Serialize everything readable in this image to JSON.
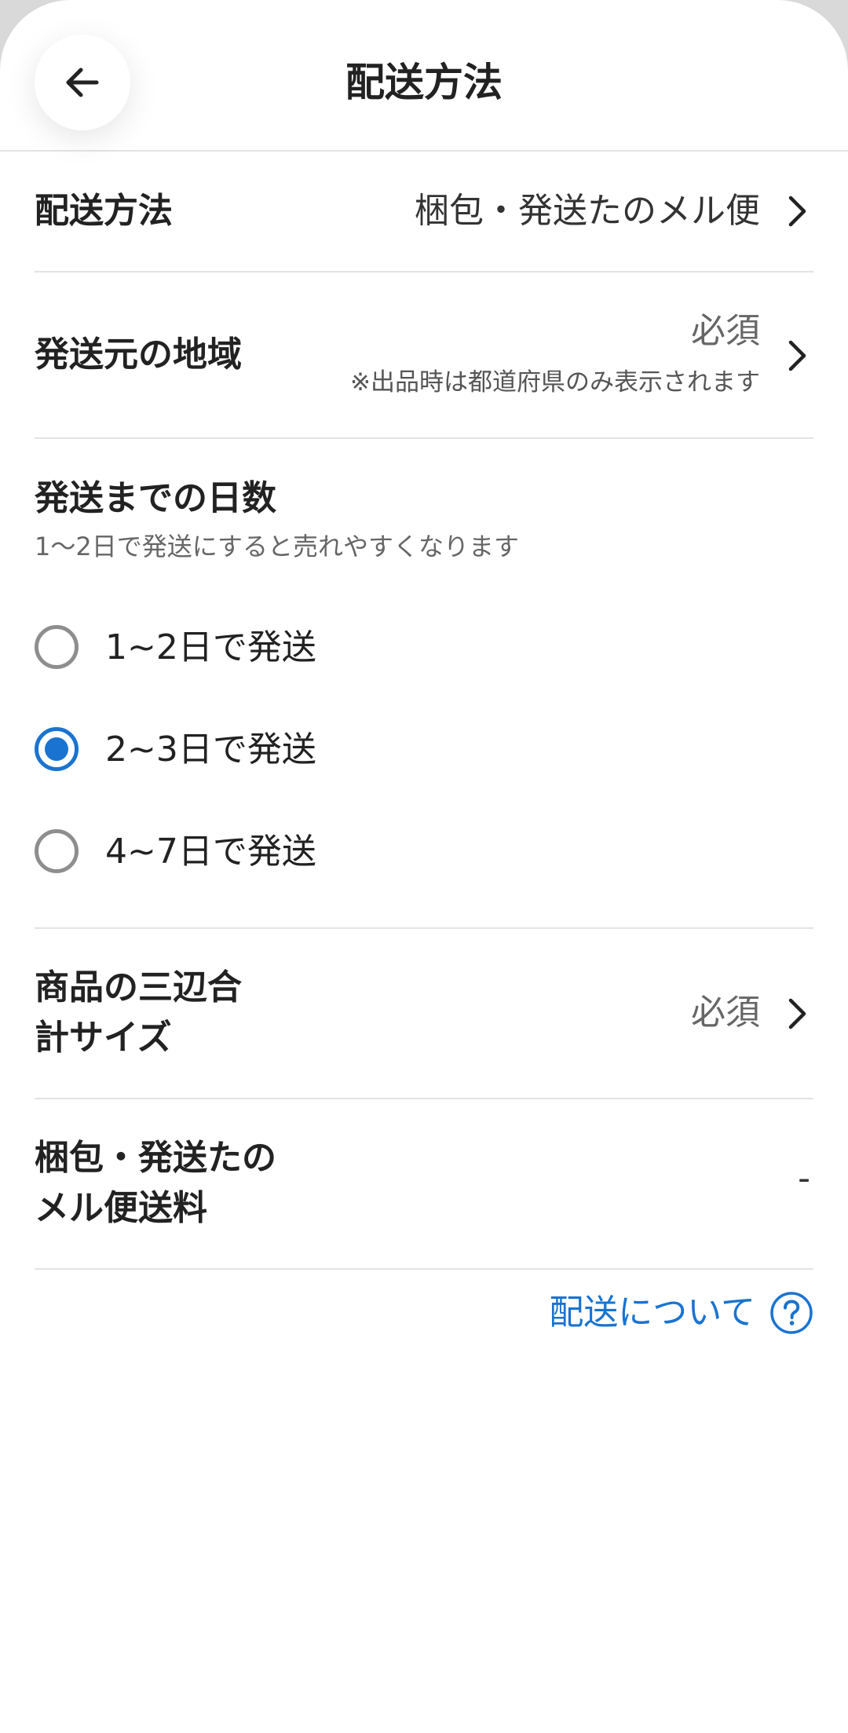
{
  "header": {
    "title": "配送方法",
    "back_icon": "arrow-left-icon"
  },
  "rows": {
    "shipping_method": {
      "label": "配送方法",
      "value": "梱包・発送たのメル便"
    },
    "origin_region": {
      "label": "発送元の地域",
      "value": "必須",
      "note": "※出品時は都道府県のみ表示されます"
    }
  },
  "days_section": {
    "title": "発送までの日数",
    "subtitle": "1〜2日で発送にすると売れやすくなります",
    "options": [
      {
        "label": "1~2日で発送",
        "selected": false
      },
      {
        "label": "2~3日で発送",
        "selected": true
      },
      {
        "label": "4~7日で発送",
        "selected": false
      }
    ]
  },
  "size_row": {
    "label_line1": "商品の三辺合",
    "label_line2": "計サイズ",
    "value": "必須"
  },
  "fee_row": {
    "label_line1": "梱包・発送たの",
    "label_line2": "メル便送料",
    "value": "-"
  },
  "help": {
    "text": "配送について",
    "icon": "question-circle-icon"
  },
  "colors": {
    "accent": "#1a73d0",
    "divider": "#e3e3e3",
    "radio_off": "#8e8e8e"
  }
}
